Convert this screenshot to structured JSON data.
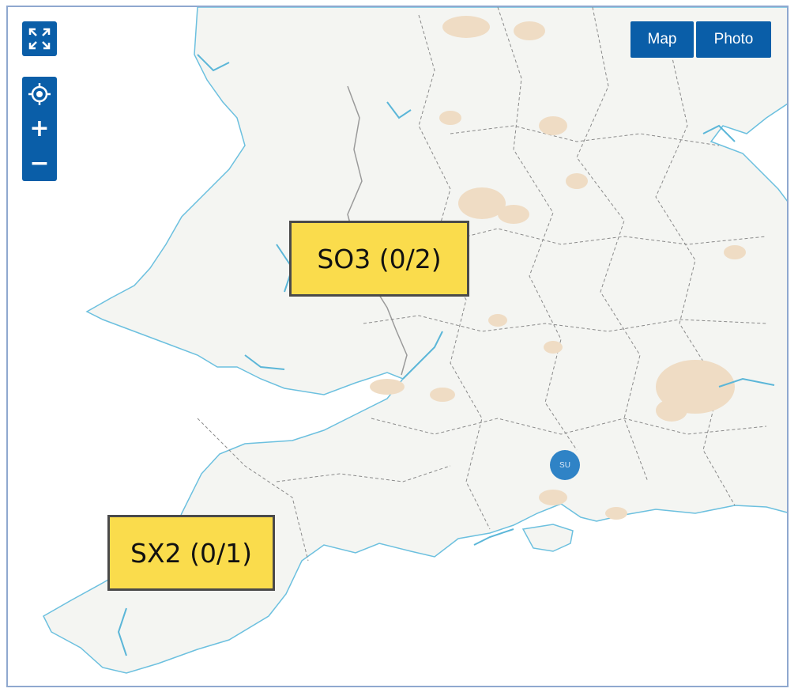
{
  "controls": {
    "fullscreen_icon": "expand-arrows-icon",
    "locate_icon": "crosshair-locate-icon",
    "zoom_in_label": "+",
    "zoom_out_label": "−"
  },
  "layers": {
    "map_label": "Map",
    "photo_label": "Photo"
  },
  "tiles": [
    {
      "label": "SO3 (0/2)"
    },
    {
      "label": "SX2 (0/1)"
    }
  ],
  "marker": {
    "label": "SU"
  },
  "colors": {
    "accent": "#0a5ea8",
    "label_fill": "#fadc4c",
    "marker": "#2f83c6",
    "land": "#f4f5f2",
    "urban": "#efdcc4",
    "water": "#5bb6d8"
  }
}
